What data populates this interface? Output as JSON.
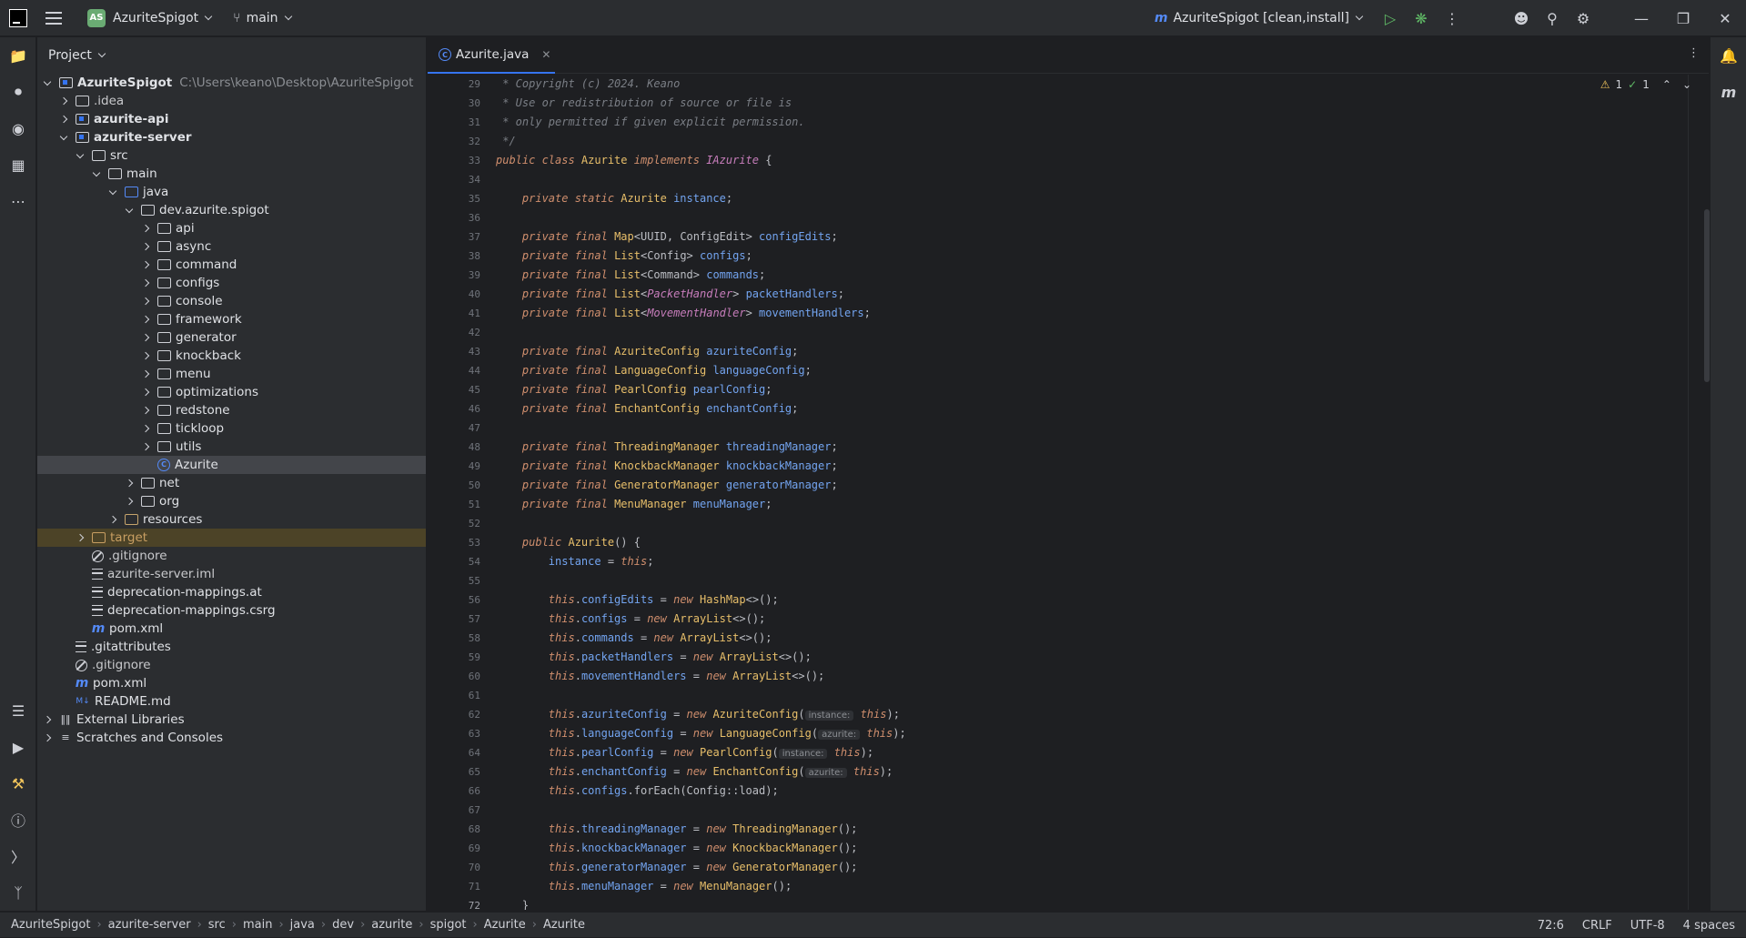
{
  "titlebar": {
    "project_initials": "AS",
    "project_name": "AzuriteSpigot",
    "branch": "main",
    "run_config": "AzuriteSpigot [clean,install]"
  },
  "project_panel": {
    "title": "Project",
    "root_name": "AzuriteSpigot",
    "root_path": "C:\\Users\\keano\\Desktop\\AzuriteSpigot",
    "items": [
      {
        "label": ".idea",
        "level": 1,
        "expand": "r",
        "icon": "folder",
        "tint": "#c8c9cc"
      },
      {
        "label": "azurite-api",
        "level": 1,
        "expand": "r",
        "icon": "module"
      },
      {
        "label": "azurite-server",
        "level": 1,
        "expand": "d",
        "icon": "module"
      },
      {
        "label": "src",
        "level": 2,
        "expand": "d",
        "icon": "folder"
      },
      {
        "label": "main",
        "level": 3,
        "expand": "d",
        "icon": "folder"
      },
      {
        "label": "java",
        "level": 4,
        "expand": "d",
        "icon": "source-folder"
      },
      {
        "label": "dev.azurite.spigot",
        "level": 5,
        "expand": "d",
        "icon": "folder"
      },
      {
        "label": "api",
        "level": 6,
        "expand": "r",
        "icon": "folder"
      },
      {
        "label": "async",
        "level": 6,
        "expand": "r",
        "icon": "folder"
      },
      {
        "label": "command",
        "level": 6,
        "expand": "r",
        "icon": "folder"
      },
      {
        "label": "configs",
        "level": 6,
        "expand": "r",
        "icon": "folder"
      },
      {
        "label": "console",
        "level": 6,
        "expand": "r",
        "icon": "folder"
      },
      {
        "label": "framework",
        "level": 6,
        "expand": "r",
        "icon": "folder"
      },
      {
        "label": "generator",
        "level": 6,
        "expand": "r",
        "icon": "folder"
      },
      {
        "label": "knockback",
        "level": 6,
        "expand": "r",
        "icon": "folder"
      },
      {
        "label": "menu",
        "level": 6,
        "expand": "r",
        "icon": "folder"
      },
      {
        "label": "optimizations",
        "level": 6,
        "expand": "r",
        "icon": "folder"
      },
      {
        "label": "redstone",
        "level": 6,
        "expand": "r",
        "icon": "folder"
      },
      {
        "label": "tickloop",
        "level": 6,
        "expand": "r",
        "icon": "folder"
      },
      {
        "label": "utils",
        "level": 6,
        "expand": "r",
        "icon": "folder"
      },
      {
        "label": "Azurite",
        "level": 6,
        "expand": "n",
        "icon": "class",
        "selected": true
      },
      {
        "label": "net",
        "level": 5,
        "expand": "r",
        "icon": "folder"
      },
      {
        "label": "org",
        "level": 5,
        "expand": "r",
        "icon": "folder"
      },
      {
        "label": "resources",
        "level": 4,
        "expand": "r",
        "icon": "resource-folder"
      },
      {
        "label": "target",
        "level": 2,
        "expand": "r",
        "icon": "target-folder",
        "excluded": true,
        "tint": "#c89e62"
      },
      {
        "label": ".gitignore",
        "level": 2,
        "expand": "n",
        "icon": "ignore",
        "tint": "#c8c9cc"
      },
      {
        "label": "azurite-server.iml",
        "level": 2,
        "expand": "n",
        "icon": "text",
        "tint": "#c8c9cc"
      },
      {
        "label": "deprecation-mappings.at",
        "level": 2,
        "expand": "n",
        "icon": "text"
      },
      {
        "label": "deprecation-mappings.csrg",
        "level": 2,
        "expand": "n",
        "icon": "text"
      },
      {
        "label": "pom.xml",
        "level": 2,
        "expand": "n",
        "icon": "maven"
      },
      {
        "label": ".gitattributes",
        "level": 1,
        "expand": "n",
        "icon": "text"
      },
      {
        "label": ".gitignore",
        "level": 1,
        "expand": "n",
        "icon": "ignore",
        "tint": "#c8c9cc"
      },
      {
        "label": "pom.xml",
        "level": 1,
        "expand": "n",
        "icon": "maven"
      },
      {
        "label": "README.md",
        "level": 1,
        "expand": "n",
        "icon": "markdown"
      },
      {
        "label": "External Libraries",
        "level": 0,
        "expand": "r",
        "icon": "library"
      },
      {
        "label": "Scratches and Consoles",
        "level": 0,
        "expand": "r",
        "icon": "scratch"
      }
    ]
  },
  "editor": {
    "tab_label": "Azurite.java",
    "inspections": {
      "warnings": "1",
      "ok": "1"
    },
    "first_line": 29,
    "current_line": 72,
    "lines": [
      [
        [
          "cm",
          " * Copyright (c) 2024. Keano"
        ]
      ],
      [
        [
          "cm",
          " * Use or redistribution of source or file is"
        ]
      ],
      [
        [
          "cm",
          " * only permitted if given explicit permission."
        ]
      ],
      [
        [
          "cm",
          " */"
        ]
      ],
      [
        [
          "kw",
          "public class "
        ],
        [
          "cls",
          "Azurite "
        ],
        [
          "kw",
          "implements "
        ],
        [
          "ifc",
          "IAzurite"
        ],
        [
          "p",
          " {"
        ]
      ],
      [],
      [
        [
          "p",
          "    "
        ],
        [
          "kw",
          "private static "
        ],
        [
          "cls",
          "Azurite "
        ],
        [
          "fld",
          "instance"
        ],
        [
          "p",
          ";"
        ]
      ],
      [],
      [
        [
          "p",
          "    "
        ],
        [
          "kw",
          "private final "
        ],
        [
          "cls",
          "Map"
        ],
        [
          "p",
          "<UUID, ConfigEdit> "
        ],
        [
          "fld",
          "configEdits"
        ],
        [
          "p",
          ";"
        ]
      ],
      [
        [
          "p",
          "    "
        ],
        [
          "kw",
          "private final "
        ],
        [
          "cls",
          "List"
        ],
        [
          "p",
          "<Config> "
        ],
        [
          "fld",
          "configs"
        ],
        [
          "p",
          ";"
        ]
      ],
      [
        [
          "p",
          "    "
        ],
        [
          "kw",
          "private final "
        ],
        [
          "cls",
          "List"
        ],
        [
          "p",
          "<Command> "
        ],
        [
          "fld",
          "commands"
        ],
        [
          "p",
          ";"
        ]
      ],
      [
        [
          "p",
          "    "
        ],
        [
          "kw",
          "private final "
        ],
        [
          "cls",
          "List"
        ],
        [
          "p",
          "<"
        ],
        [
          "ifc",
          "PacketHandler"
        ],
        [
          "p",
          "> "
        ],
        [
          "fld",
          "packetHandlers"
        ],
        [
          "p",
          ";"
        ]
      ],
      [
        [
          "p",
          "    "
        ],
        [
          "kw",
          "private final "
        ],
        [
          "cls",
          "List"
        ],
        [
          "p",
          "<"
        ],
        [
          "ifc",
          "MovementHandler"
        ],
        [
          "p",
          "> "
        ],
        [
          "fld",
          "movementHandlers"
        ],
        [
          "p",
          ";"
        ]
      ],
      [],
      [
        [
          "p",
          "    "
        ],
        [
          "kw",
          "private final "
        ],
        [
          "cls",
          "AzuriteConfig "
        ],
        [
          "fld",
          "azuriteConfig"
        ],
        [
          "p",
          ";"
        ]
      ],
      [
        [
          "p",
          "    "
        ],
        [
          "kw",
          "private final "
        ],
        [
          "cls",
          "LanguageConfig "
        ],
        [
          "fld",
          "languageConfig"
        ],
        [
          "p",
          ";"
        ]
      ],
      [
        [
          "p",
          "    "
        ],
        [
          "kw",
          "private final "
        ],
        [
          "cls",
          "PearlConfig "
        ],
        [
          "fld",
          "pearlConfig"
        ],
        [
          "p",
          ";"
        ]
      ],
      [
        [
          "p",
          "    "
        ],
        [
          "kw",
          "private final "
        ],
        [
          "cls",
          "EnchantConfig "
        ],
        [
          "fld",
          "enchantConfig"
        ],
        [
          "p",
          ";"
        ]
      ],
      [],
      [
        [
          "p",
          "    "
        ],
        [
          "kw",
          "private final "
        ],
        [
          "cls",
          "ThreadingManager "
        ],
        [
          "fld",
          "threadingManager"
        ],
        [
          "p",
          ";"
        ]
      ],
      [
        [
          "p",
          "    "
        ],
        [
          "kw",
          "private final "
        ],
        [
          "cls",
          "KnockbackManager "
        ],
        [
          "fld",
          "knockbackManager"
        ],
        [
          "p",
          ";"
        ]
      ],
      [
        [
          "p",
          "    "
        ],
        [
          "kw",
          "private final "
        ],
        [
          "cls",
          "GeneratorManager "
        ],
        [
          "fld",
          "generatorManager"
        ],
        [
          "p",
          ";"
        ]
      ],
      [
        [
          "p",
          "    "
        ],
        [
          "kw",
          "private final "
        ],
        [
          "cls",
          "MenuManager "
        ],
        [
          "fld",
          "menuManager"
        ],
        [
          "p",
          ";"
        ]
      ],
      [],
      [
        [
          "p",
          "    "
        ],
        [
          "kw",
          "public "
        ],
        [
          "cls",
          "Azurite"
        ],
        [
          "p",
          "() {"
        ]
      ],
      [
        [
          "p",
          "        "
        ],
        [
          "fld",
          "instance"
        ],
        [
          "p",
          " = "
        ],
        [
          "kw",
          "this"
        ],
        [
          "p",
          ";"
        ]
      ],
      [],
      [
        [
          "p",
          "        "
        ],
        [
          "kw",
          "this"
        ],
        [
          "p",
          "."
        ],
        [
          "fld",
          "configEdits"
        ],
        [
          "p",
          " = "
        ],
        [
          "kw",
          "new "
        ],
        [
          "cls",
          "HashMap"
        ],
        [
          "p",
          "<>();"
        ]
      ],
      [
        [
          "p",
          "        "
        ],
        [
          "kw",
          "this"
        ],
        [
          "p",
          "."
        ],
        [
          "fld",
          "configs"
        ],
        [
          "p",
          " = "
        ],
        [
          "kw",
          "new "
        ],
        [
          "cls",
          "ArrayList"
        ],
        [
          "p",
          "<>();"
        ]
      ],
      [
        [
          "p",
          "        "
        ],
        [
          "kw",
          "this"
        ],
        [
          "p",
          "."
        ],
        [
          "fld",
          "commands"
        ],
        [
          "p",
          " = "
        ],
        [
          "kw",
          "new "
        ],
        [
          "cls",
          "ArrayList"
        ],
        [
          "p",
          "<>();"
        ]
      ],
      [
        [
          "p",
          "        "
        ],
        [
          "kw",
          "this"
        ],
        [
          "p",
          "."
        ],
        [
          "fld",
          "packetHandlers"
        ],
        [
          "p",
          " = "
        ],
        [
          "kw",
          "new "
        ],
        [
          "cls",
          "ArrayList"
        ],
        [
          "p",
          "<>();"
        ]
      ],
      [
        [
          "p",
          "        "
        ],
        [
          "kw",
          "this"
        ],
        [
          "p",
          "."
        ],
        [
          "fld",
          "movementHandlers"
        ],
        [
          "p",
          " = "
        ],
        [
          "kw",
          "new "
        ],
        [
          "cls",
          "ArrayList"
        ],
        [
          "p",
          "<>();"
        ]
      ],
      [],
      [
        [
          "p",
          "        "
        ],
        [
          "kw",
          "this"
        ],
        [
          "p",
          "."
        ],
        [
          "fld",
          "azuriteConfig"
        ],
        [
          "p",
          " = "
        ],
        [
          "kw",
          "new "
        ],
        [
          "cls",
          "AzuriteConfig"
        ],
        [
          "p",
          "("
        ],
        [
          "hint",
          "instance:"
        ],
        [
          "p",
          " "
        ],
        [
          "kw",
          "this"
        ],
        [
          "p",
          ");"
        ]
      ],
      [
        [
          "p",
          "        "
        ],
        [
          "kw",
          "this"
        ],
        [
          "p",
          "."
        ],
        [
          "fld",
          "languageConfig"
        ],
        [
          "p",
          " = "
        ],
        [
          "kw",
          "new "
        ],
        [
          "cls",
          "LanguageConfig"
        ],
        [
          "p",
          "("
        ],
        [
          "hint",
          "azurite:"
        ],
        [
          "p",
          " "
        ],
        [
          "kw",
          "this"
        ],
        [
          "p",
          ");"
        ]
      ],
      [
        [
          "p",
          "        "
        ],
        [
          "kw",
          "this"
        ],
        [
          "p",
          "."
        ],
        [
          "fld",
          "pearlConfig"
        ],
        [
          "p",
          " = "
        ],
        [
          "kw",
          "new "
        ],
        [
          "cls",
          "PearlConfig"
        ],
        [
          "p",
          "("
        ],
        [
          "hint",
          "instance:"
        ],
        [
          "p",
          " "
        ],
        [
          "kw",
          "this"
        ],
        [
          "p",
          ");"
        ]
      ],
      [
        [
          "p",
          "        "
        ],
        [
          "kw",
          "this"
        ],
        [
          "p",
          "."
        ],
        [
          "fld",
          "enchantConfig"
        ],
        [
          "p",
          " = "
        ],
        [
          "kw",
          "new "
        ],
        [
          "cls",
          "EnchantConfig"
        ],
        [
          "p",
          "("
        ],
        [
          "hint",
          "azurite:"
        ],
        [
          "p",
          " "
        ],
        [
          "kw",
          "this"
        ],
        [
          "p",
          ");"
        ]
      ],
      [
        [
          "p",
          "        "
        ],
        [
          "kw",
          "this"
        ],
        [
          "p",
          "."
        ],
        [
          "fld",
          "configs"
        ],
        [
          "p",
          ".forEach(Config::load);"
        ]
      ],
      [],
      [
        [
          "p",
          "        "
        ],
        [
          "kw",
          "this"
        ],
        [
          "p",
          "."
        ],
        [
          "fld",
          "threadingManager"
        ],
        [
          "p",
          " = "
        ],
        [
          "kw",
          "new "
        ],
        [
          "cls",
          "ThreadingManager"
        ],
        [
          "p",
          "();"
        ]
      ],
      [
        [
          "p",
          "        "
        ],
        [
          "kw",
          "this"
        ],
        [
          "p",
          "."
        ],
        [
          "fld",
          "knockbackManager"
        ],
        [
          "p",
          " = "
        ],
        [
          "kw",
          "new "
        ],
        [
          "cls",
          "KnockbackManager"
        ],
        [
          "p",
          "();"
        ]
      ],
      [
        [
          "p",
          "        "
        ],
        [
          "kw",
          "this"
        ],
        [
          "p",
          "."
        ],
        [
          "fld",
          "generatorManager"
        ],
        [
          "p",
          " = "
        ],
        [
          "kw",
          "new "
        ],
        [
          "cls",
          "GeneratorManager"
        ],
        [
          "p",
          "();"
        ]
      ],
      [
        [
          "p",
          "        "
        ],
        [
          "kw",
          "this"
        ],
        [
          "p",
          "."
        ],
        [
          "fld",
          "menuManager"
        ],
        [
          "p",
          " = "
        ],
        [
          "kw",
          "new "
        ],
        [
          "cls",
          "MenuManager"
        ],
        [
          "p",
          "();"
        ]
      ],
      [
        [
          "p",
          "    }"
        ]
      ]
    ]
  },
  "statusbar": {
    "breadcrumbs": [
      "AzuriteSpigot",
      "azurite-server",
      "src",
      "main",
      "java",
      "dev",
      "azurite",
      "spigot",
      "Azurite",
      "Azurite"
    ],
    "position": "72:6",
    "line_sep": "CRLF",
    "encoding": "UTF-8",
    "indent": "4 spaces"
  },
  "colors": {
    "background": "#1e1f22",
    "panel": "#2b2d30",
    "accent": "#3574f0",
    "keyword": "#cf8e6d",
    "class": "#e8bf6a",
    "field": "#73a4f0",
    "comment": "#7a7e85"
  }
}
